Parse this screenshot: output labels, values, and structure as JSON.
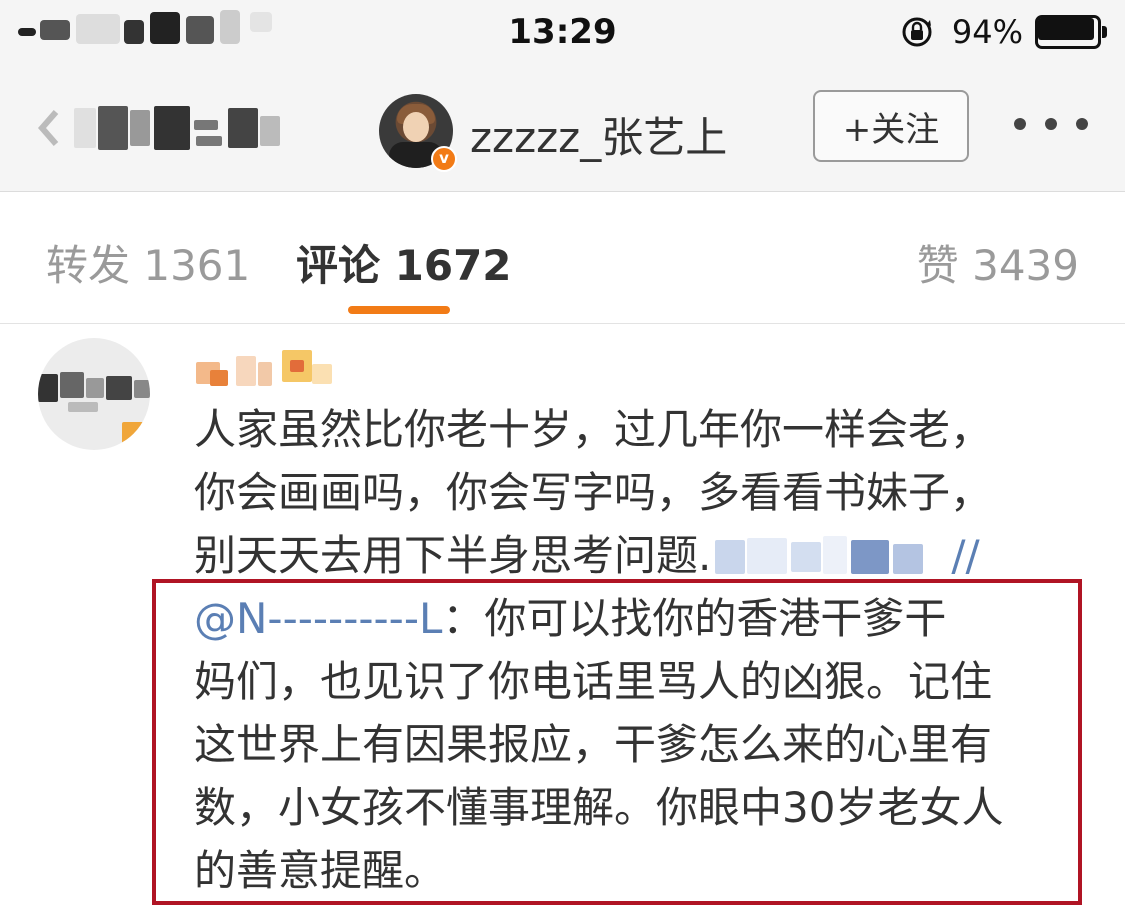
{
  "status_bar": {
    "time": "13:29",
    "battery_percent_text": "94%",
    "battery_level": 0.94
  },
  "nav": {
    "back_icon": "chevron-left-icon",
    "username": "zzzzz_张艺上",
    "verified_badge": "v",
    "follow_label": "+关注",
    "more_icon": "more-dots-icon"
  },
  "tabs": [
    {
      "label": "转发 1361",
      "active": false
    },
    {
      "label": "评论 1672",
      "active": true
    },
    {
      "label": "赞 3439",
      "active": false
    }
  ],
  "comment": {
    "lines": [
      "人家虽然比你老十岁，过几年你一样会老，",
      "你会画画吗，你会写字吗，多看看书妹子，",
      "别天天去用下半身思考问题."
    ],
    "separator": "//",
    "mention": "@N----------L",
    "quoted_first": "：你可以找你的香港干爹干",
    "quoted_lines": [
      "妈们，也见识了你电话里骂人的凶狠。记住",
      "这世界上有因果报应，干爹怎么来的心里有",
      "数，小女孩不懂事理解。你眼中30岁老女人",
      "的善意提醒。"
    ]
  },
  "colors": {
    "accent_orange": "#f27b16",
    "mention_blue": "#5b7fb4",
    "highlight_red": "#b01424",
    "header_bg": "#f5f5f5"
  }
}
